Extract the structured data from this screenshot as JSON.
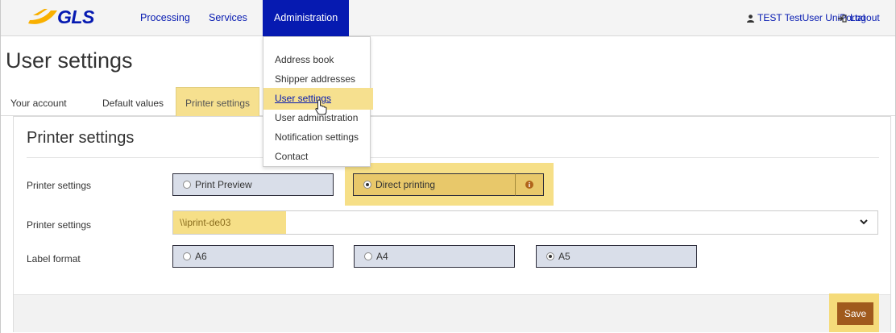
{
  "nav": {
    "logo_text": "GLS",
    "items": [
      {
        "label": "Processing"
      },
      {
        "label": "Services"
      },
      {
        "label": "Administration"
      }
    ],
    "user": "TEST TestUser UniPortal",
    "logout": "Logout"
  },
  "page_title": "User settings",
  "tabs": [
    {
      "label": "Your account"
    },
    {
      "label": "Default values"
    },
    {
      "label": "Printer settings"
    }
  ],
  "panel": {
    "title": "Printer settings",
    "rows": [
      {
        "label": "Printer settings",
        "options": [
          {
            "label": "Print Preview",
            "selected": false
          },
          {
            "label": "Direct printing",
            "selected": true
          }
        ]
      },
      {
        "label": "Printer settings",
        "select_value": "\\\\iprint-de03"
      },
      {
        "label": "Label format",
        "options": [
          {
            "label": "A6",
            "selected": false
          },
          {
            "label": "A4",
            "selected": false
          },
          {
            "label": "A5",
            "selected": true
          }
        ]
      }
    ],
    "save_label": "Save"
  },
  "dropdown": {
    "items": [
      {
        "label": "Address book"
      },
      {
        "label": "Shipper addresses"
      },
      {
        "label": "User settings"
      },
      {
        "label": "User administration"
      },
      {
        "label": "Notification settings"
      },
      {
        "label": "Contact"
      }
    ]
  },
  "colors": {
    "brand_blue": "#061ab1",
    "logo_yellow": "#f9b000",
    "highlight": "#f5db7a",
    "save_button": "#a05a1d",
    "option_bg": "#d9dee9"
  }
}
